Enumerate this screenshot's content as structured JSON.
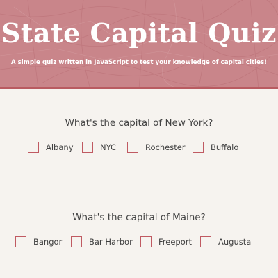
{
  "header": {
    "title": "State Capital Quiz",
    "subtitle": "A simple quiz written in JavaScript to test your knowledge of capital cities!"
  },
  "questions": [
    {
      "text": "What's the capital of New York?",
      "options": [
        "Albany",
        "NYC",
        "Rochester",
        "Buffalo"
      ]
    },
    {
      "text": "What's the capital of Maine?",
      "options": [
        "Bangor",
        "Bar Harbor",
        "Freeport",
        "Augusta"
      ]
    }
  ],
  "colors": {
    "header_bg": "#c9858a",
    "accent": "#c05a62",
    "divider": "#e6a8ad",
    "page_bg": "#f6f3ef"
  }
}
